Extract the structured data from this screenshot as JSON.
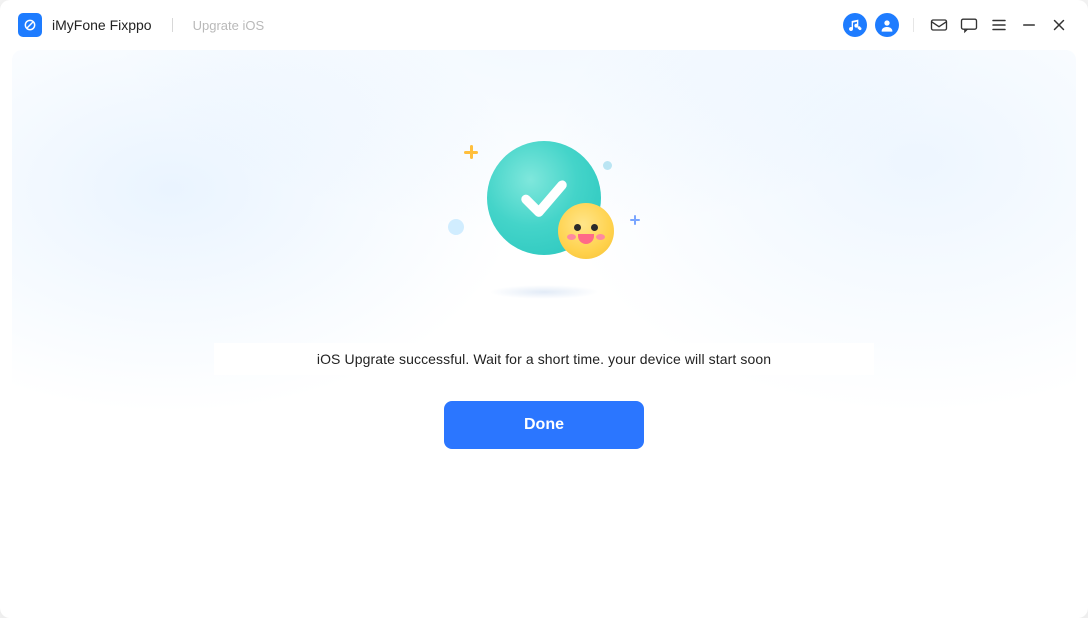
{
  "titlebar": {
    "app_name": "iMyFone Fixppo",
    "breadcrumb": "Upgrate iOS"
  },
  "icons": {
    "music": "music-icon",
    "account": "account-icon",
    "mail": "mail-icon",
    "chat": "chat-icon",
    "menu": "menu-icon",
    "minimize": "minimize-icon",
    "close": "close-icon"
  },
  "main": {
    "status_message": "iOS Upgrate successful. Wait for a short time. your device will start soon",
    "done_label": "Done"
  },
  "colors": {
    "accent": "#2b76ff",
    "success_circle": "#3cd3c7",
    "emoji": "#ffd24d"
  }
}
